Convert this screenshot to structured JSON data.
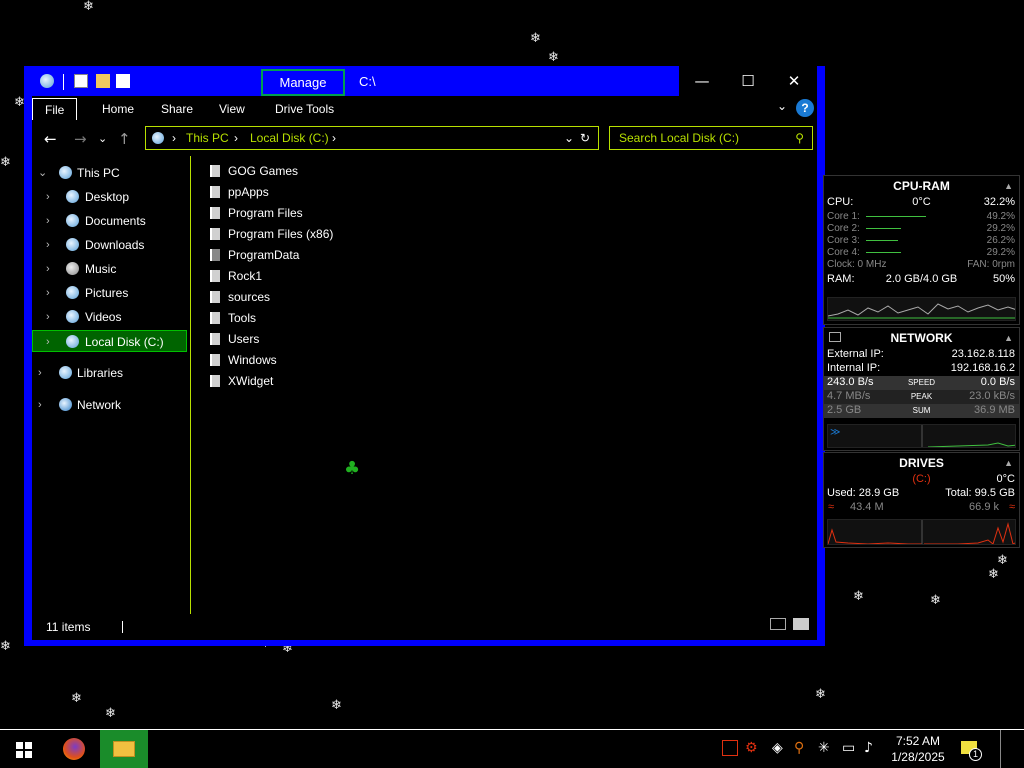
{
  "window": {
    "title": "C:\\",
    "manage_tab": "Manage",
    "minimize_glyph": "—",
    "maximize_glyph": "☐",
    "close_glyph": "✕"
  },
  "ribbon": {
    "tabs": [
      "File",
      "Home",
      "Share",
      "View",
      "Drive Tools"
    ],
    "help_glyph": "?",
    "expand_glyph": "⌄"
  },
  "navbar": {
    "back_glyph": "←",
    "forward_glyph": "→",
    "recent_glyph": "⌄",
    "up_glyph": "↑",
    "breadcrumb": [
      "This PC",
      "Local Disk (C:)"
    ],
    "search_placeholder": "Search Local Disk (C:)"
  },
  "nav_pane": {
    "items": [
      {
        "label": "This PC",
        "icon": "this-pc-icon",
        "expanded": true
      },
      {
        "label": "Desktop",
        "icon": "desktop-icon"
      },
      {
        "label": "Documents",
        "icon": "documents-icon"
      },
      {
        "label": "Downloads",
        "icon": "downloads-icon"
      },
      {
        "label": "Music",
        "icon": "music-icon"
      },
      {
        "label": "Pictures",
        "icon": "pictures-icon"
      },
      {
        "label": "Videos",
        "icon": "videos-icon"
      },
      {
        "label": "Local Disk (C:)",
        "icon": "drive-icon",
        "selected": true
      },
      {
        "label": "Libraries",
        "icon": "libraries-icon"
      },
      {
        "label": "Network",
        "icon": "network-icon"
      }
    ]
  },
  "files": [
    {
      "name": "GOG Games"
    },
    {
      "name": "ppApps"
    },
    {
      "name": "Program Files"
    },
    {
      "name": "Program Files (x86)"
    },
    {
      "name": "ProgramData"
    },
    {
      "name": "Rock1"
    },
    {
      "name": "sources"
    },
    {
      "name": "Tools"
    },
    {
      "name": "Users"
    },
    {
      "name": "Windows"
    },
    {
      "name": "XWidget"
    }
  ],
  "status": {
    "item_count": "11 items"
  },
  "cpu_ram": {
    "title": "CPU-RAM",
    "cpu_label": "CPU:",
    "cpu_temp": "0°C",
    "cpu_usage": "32.2%",
    "cores": [
      {
        "label": "Core 1:",
        "value": "49.2%"
      },
      {
        "label": "Core 2:",
        "value": "29.2%"
      },
      {
        "label": "Core 3:",
        "value": "26.2%"
      },
      {
        "label": "Core 4:",
        "value": "29.2%"
      }
    ],
    "clock": "Clock: 0 MHz",
    "fan": "FAN: 0rpm",
    "ram_label": "RAM:",
    "ram_used": "2.0 GB/4.0 GB",
    "ram_pct": "50%"
  },
  "network": {
    "title": "NETWORK",
    "external_ip_label": "External IP:",
    "external_ip": "23.162.8.118",
    "internal_ip_label": "Internal IP:",
    "internal_ip": "192.168.16.2",
    "speed_down": "243.0 B/s",
    "speed_label": "SPEED",
    "speed_up": "0.0 B/s",
    "peak_down": "4.7 MB/s",
    "peak_label": "PEAK",
    "peak_up": "23.0 kB/s",
    "sum_down": "2.5 GB",
    "sum_label": "SUM",
    "sum_up": "36.9 MB"
  },
  "drives": {
    "title": "DRIVES",
    "drive_letter": "(C:)",
    "temp": "0°C",
    "used": "Used: 28.9 GB",
    "total": "Total: 99.5 GB",
    "read": "43.4 M",
    "write": "66.9 k"
  },
  "taskbar": {
    "clock_time": "7:52 AM",
    "clock_date": "1/28/2025",
    "notification_count": "1"
  },
  "colors": {
    "window_frame": "#0000ff",
    "accent_lime": "#b8e000",
    "selection_green": "#006400",
    "help_blue": "#1a7ad4",
    "graph_red": "#e03010",
    "graph_green": "#40c040"
  }
}
